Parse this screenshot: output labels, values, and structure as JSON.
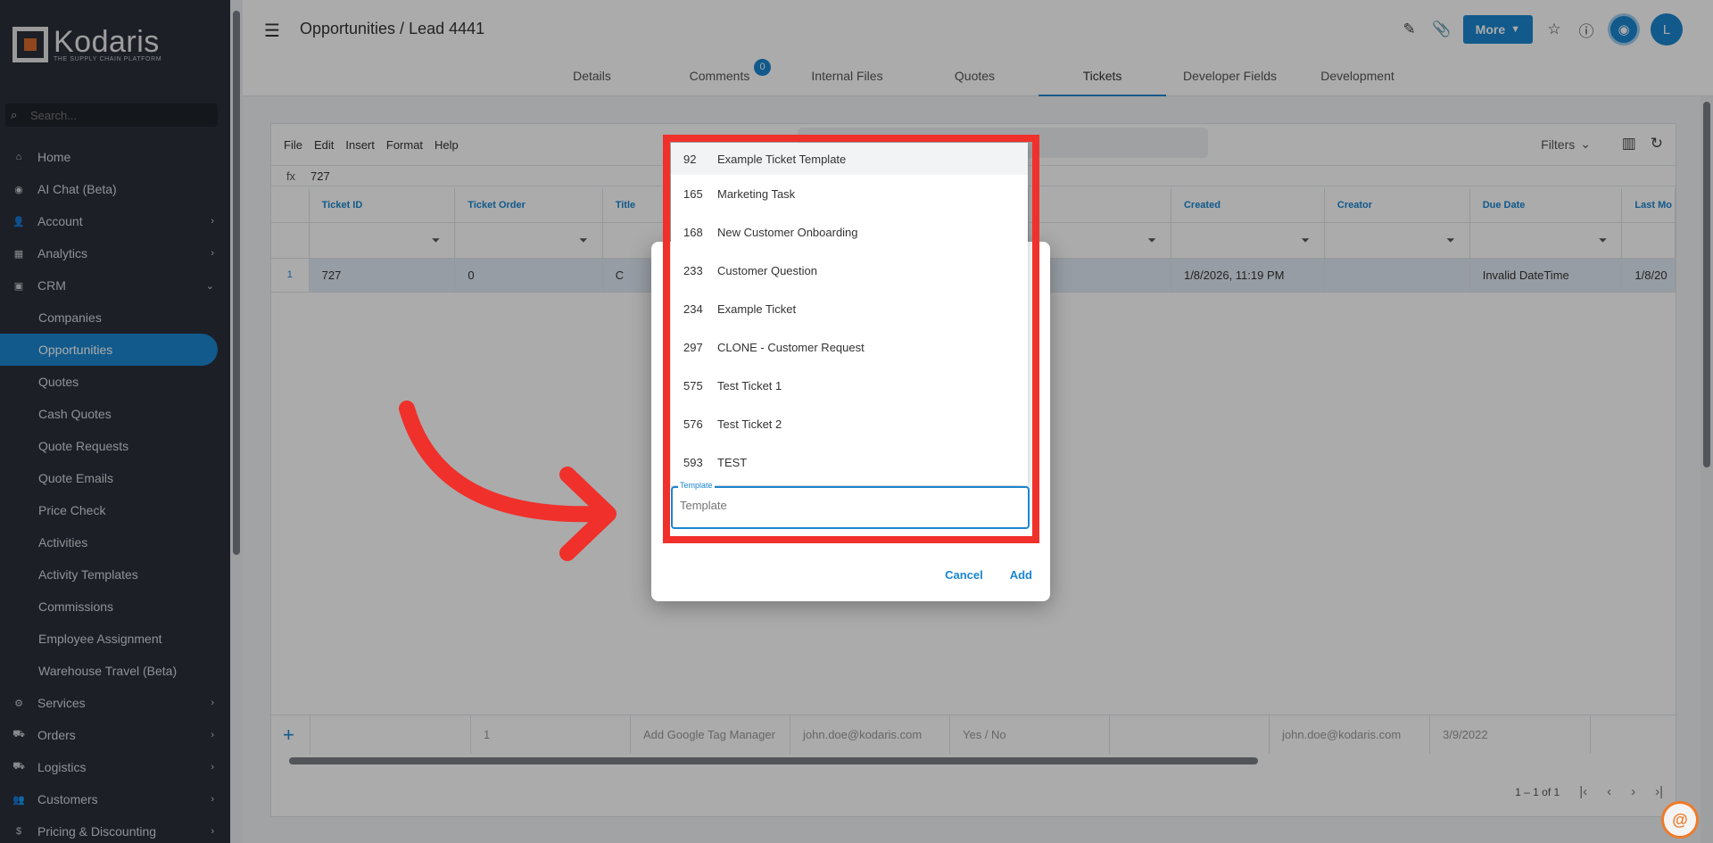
{
  "sidebar": {
    "logo_name": "Kodaris",
    "logo_tagline": "THE SUPPLY CHAIN PLATFORM",
    "search_placeholder": "Search...",
    "items": [
      {
        "label": "Home",
        "icon": "home-icon",
        "glyph": "⌂"
      },
      {
        "label": "AI Chat (Beta)",
        "icon": "robot-icon",
        "glyph": "◉"
      },
      {
        "label": "Account",
        "icon": "user-icon",
        "glyph": "👤",
        "chevron": "›"
      },
      {
        "label": "Analytics",
        "icon": "analytics-icon",
        "glyph": "▦",
        "chevron": "›"
      },
      {
        "label": "CRM",
        "icon": "crm-icon",
        "glyph": "▣",
        "chevron": "⌄"
      },
      {
        "label": "Companies"
      },
      {
        "label": "Opportunities"
      },
      {
        "label": "Quotes"
      },
      {
        "label": "Cash Quotes"
      },
      {
        "label": "Quote Requests"
      },
      {
        "label": "Quote Emails"
      },
      {
        "label": "Price Check"
      },
      {
        "label": "Activities"
      },
      {
        "label": "Activity Templates"
      },
      {
        "label": "Commissions"
      },
      {
        "label": "Employee Assignment"
      },
      {
        "label": "Warehouse Travel (Beta)"
      },
      {
        "label": "Services",
        "icon": "services-icon",
        "glyph": "⚙",
        "chevron": "›"
      },
      {
        "label": "Orders",
        "icon": "truck-icon",
        "glyph": "⛟",
        "chevron": "›"
      },
      {
        "label": "Logistics",
        "icon": "logistics-icon",
        "glyph": "⛟",
        "chevron": "›"
      },
      {
        "label": "Customers",
        "icon": "customers-icon",
        "glyph": "👥",
        "chevron": "›"
      },
      {
        "label": "Pricing & Discounting",
        "icon": "dollar-icon",
        "glyph": "$",
        "chevron": "›"
      }
    ]
  },
  "header": {
    "title": "Opportunities / Lead 4441",
    "more_label": "More",
    "avatar_letter": "L",
    "tabs": [
      {
        "label": "Details"
      },
      {
        "label": "Comments",
        "badge": "0"
      },
      {
        "label": "Internal Files"
      },
      {
        "label": "Quotes"
      },
      {
        "label": "Tickets"
      },
      {
        "label": "Developer Fields"
      },
      {
        "label": "Development"
      }
    ]
  },
  "grid": {
    "menu": [
      "File",
      "Edit",
      "Insert",
      "Format",
      "Help"
    ],
    "filters_label": "Filters",
    "fx_label": "fx",
    "fx_value": "727",
    "columns": [
      "Ticket ID",
      "Ticket Order",
      "Title",
      "",
      "",
      "",
      "Created",
      "Creator",
      "Due Date",
      "Last Mo"
    ],
    "row": {
      "num": "1",
      "ticket_id": "727",
      "ticket_order": "0",
      "title": "C",
      "created": "1/8/2026, 11:19 PM",
      "creator": "",
      "due_date": "Invalid DateTime",
      "last_mod": "1/8/20"
    },
    "new_row": {
      "order": "1",
      "title": "Add Google Tag Manager",
      "email": "john.doe@kodaris.com",
      "yesno": "Yes / No",
      "creator": "john.doe@kodaris.com",
      "date": "3/9/2022"
    },
    "pager_text": "1 – 1 of 1"
  },
  "dialog": {
    "options": [
      {
        "id": "92",
        "name": "Example Ticket Template"
      },
      {
        "id": "165",
        "name": "Marketing Task"
      },
      {
        "id": "168",
        "name": "New Customer Onboarding"
      },
      {
        "id": "233",
        "name": "Customer Question"
      },
      {
        "id": "234",
        "name": "Example Ticket"
      },
      {
        "id": "297",
        "name": "CLONE - Customer Request"
      },
      {
        "id": "575",
        "name": "Test Ticket 1"
      },
      {
        "id": "576",
        "name": "Test Ticket 2"
      },
      {
        "id": "593",
        "name": "TEST"
      }
    ],
    "template_label": "Template",
    "template_placeholder": "Template",
    "cancel_label": "Cancel",
    "add_label": "Add"
  },
  "colors": {
    "accent": "#1a86d0",
    "sidebar_bg": "#2a2f3a",
    "highlight_red": "#f0302b"
  }
}
